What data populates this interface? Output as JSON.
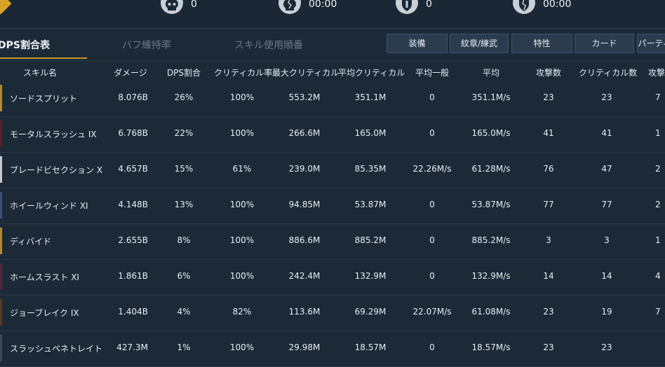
{
  "top_stats": [
    {
      "icon": "skull-icon",
      "value": "0"
    },
    {
      "icon": "shattered-skull-icon",
      "value": "00:00"
    },
    {
      "icon": "shield-crest-icon",
      "value": "0"
    },
    {
      "icon": "broken-shield-icon",
      "value": "00:00"
    }
  ],
  "tabs": [
    {
      "label": "DPS割合表"
    },
    {
      "label": "バフ維持率"
    },
    {
      "label": "スキル使用順番"
    }
  ],
  "filters": [
    {
      "label": "装備"
    },
    {
      "label": "紋章/練武"
    },
    {
      "label": "特性"
    },
    {
      "label": "カード"
    },
    {
      "label": "パーティ"
    }
  ],
  "columns": [
    "スキル名",
    "ダメージ",
    "DPS割合",
    "クリティカル率",
    "最大クリティカル",
    "平均クリティカル",
    "平均一般",
    "平均",
    "攻撃数",
    "クリティカル数",
    "攻撃"
  ],
  "rows": [
    {
      "accent": "#b5882c",
      "cells": [
        "ソードスプリット",
        "8.076B",
        "26%",
        "100%",
        "553.2M",
        "351.1M",
        "0",
        "351.1M/s",
        "23",
        "23",
        "7"
      ]
    },
    {
      "accent": "#5a1e28",
      "cells": [
        "モータルスラッシュ IX",
        "6.768B",
        "22%",
        "100%",
        "266.6M",
        "165.0M",
        "0",
        "165.0M/s",
        "41",
        "41",
        "1"
      ]
    },
    {
      "accent": "#c7c9cc",
      "cells": [
        "ブレードビセクション X",
        "4.657B",
        "15%",
        "61%",
        "239.0M",
        "85.35M",
        "22.26M/s",
        "61.28M/s",
        "76",
        "47",
        "2"
      ]
    },
    {
      "accent": "#3a4f7a",
      "cells": [
        "ホイールウィンド XI",
        "4.148B",
        "13%",
        "100%",
        "94.85M",
        "53.87M",
        "0",
        "53.87M/s",
        "77",
        "77",
        "2"
      ]
    },
    {
      "accent": "#b5882c",
      "cells": [
        "ディバイド",
        "2.655B",
        "8%",
        "100%",
        "886.6M",
        "885.2M",
        "0",
        "885.2M/s",
        "3",
        "3",
        "1"
      ]
    },
    {
      "accent": "#55233a",
      "cells": [
        "ホームスラスト XI",
        "1.861B",
        "6%",
        "100%",
        "242.4M",
        "132.9M",
        "0",
        "132.9M/s",
        "14",
        "14",
        "4"
      ]
    },
    {
      "accent": "#5a3a1e",
      "cells": [
        "ジョーブレイク IX",
        "1.404B",
        "4%",
        "82%",
        "113.6M",
        "69.29M",
        "22.07M/s",
        "61.08M/s",
        "23",
        "19",
        "7"
      ]
    },
    {
      "accent": "#3b4a5a",
      "cells": [
        "スラッシュペネトレイト",
        "427.3M",
        "1%",
        "100%",
        "29.98M",
        "18.57M",
        "0",
        "18.57M/s",
        "23",
        "23",
        ""
      ]
    }
  ]
}
